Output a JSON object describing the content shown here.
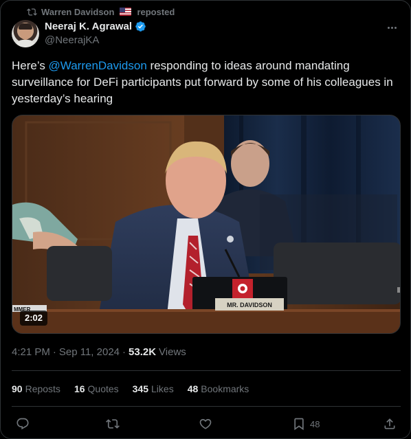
{
  "repost": {
    "reposter": "Warren Davidson",
    "label": "reposted"
  },
  "author": {
    "display_name": "Neeraj K. Agrawal",
    "handle": "@NeerajKA",
    "verified": true
  },
  "tweet": {
    "text_before": "Here’s ",
    "mention": "@WarrenDavidson",
    "text_after": " responding to ideas around mandating surveillance for DeFi participants put forward by some of his colleagues in yesterday’s hearing"
  },
  "media": {
    "nameplate": "MR. DAVIDSON",
    "side_caption": "MMER",
    "duration": "2:02"
  },
  "meta": {
    "time": "4:21 PM",
    "date": "Sep 11, 2024",
    "views_count": "53.2K",
    "views_label": "Views"
  },
  "stats": [
    {
      "count": "90",
      "label": "Reposts"
    },
    {
      "count": "16",
      "label": "Quotes"
    },
    {
      "count": "345",
      "label": "Likes"
    },
    {
      "count": "48",
      "label": "Bookmarks"
    }
  ],
  "actions": {
    "reply_icon": "reply-icon",
    "repost_icon": "repost-icon",
    "like_icon": "like-icon",
    "bookmark_icon": "bookmark-icon",
    "bookmark_count": "48",
    "share_icon": "share-icon"
  },
  "colors": {
    "accent": "#1d9bf0",
    "muted": "#71767b",
    "text": "#e7e9ea",
    "background": "#000000",
    "border": "#2f3336"
  }
}
